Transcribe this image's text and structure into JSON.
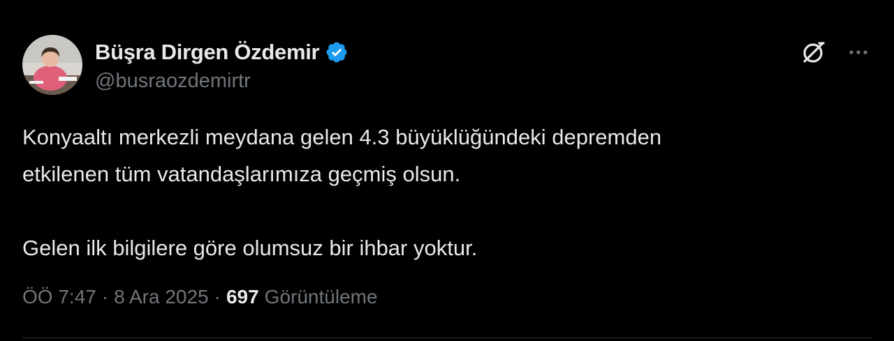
{
  "author": {
    "display_name": "Büşra Dirgen Özdemir",
    "handle": "@busraozdemirtr",
    "verified": true,
    "verified_color": "#1d9bf0"
  },
  "actions": {
    "grok_icon": "grok-icon",
    "more_icon": "more-horizontal-icon"
  },
  "tweet": {
    "line1": "Konyaaltı merkezli meydana gelen 4.3 büyüklüğündeki depremden",
    "line2": "etkilenen tüm vatandaşlarımıza geçmiş olsun.",
    "line3": "Gelen ilk bilgilere göre olumsuz bir ihbar yoktur."
  },
  "meta": {
    "time": "ÖÖ 7:47",
    "separator": "·",
    "date": "8 Ara 2025",
    "views_count": "697",
    "views_label": "Görüntüleme"
  },
  "colors": {
    "background": "#000000",
    "text_primary": "#e7e9ea",
    "text_secondary": "#71767b",
    "divider": "#2f3336"
  }
}
